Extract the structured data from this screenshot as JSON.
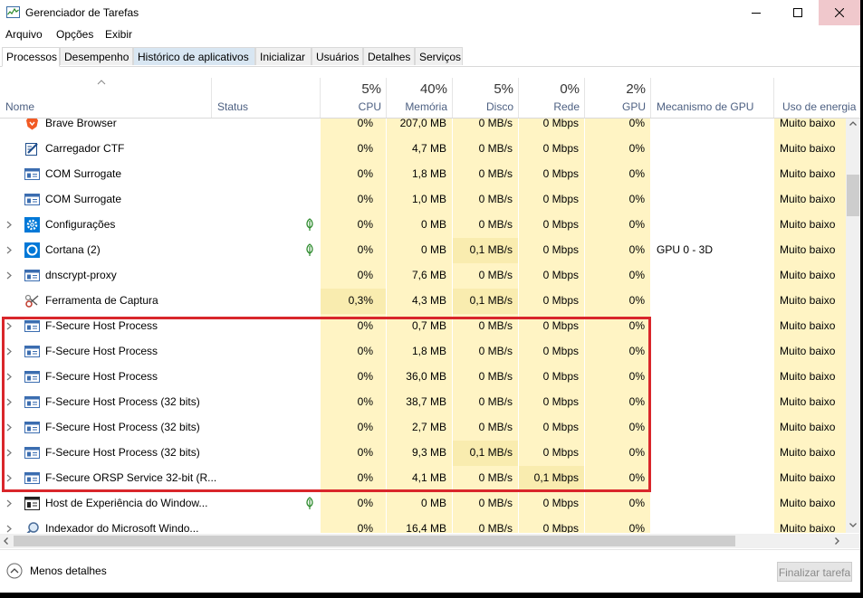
{
  "window": {
    "title": "Gerenciador de Tarefas"
  },
  "menu": [
    "Arquivo",
    "Opções",
    "Exibir"
  ],
  "tabs": [
    {
      "label": "Processos",
      "active": true
    },
    {
      "label": "Desempenho"
    },
    {
      "label": "Histórico de aplicativos",
      "hover": true
    },
    {
      "label": "Inicializar"
    },
    {
      "label": "Usuários"
    },
    {
      "label": "Detalhes"
    },
    {
      "label": "Serviços"
    }
  ],
  "columns": {
    "name": "Nome",
    "status": "Status",
    "cpu": {
      "pct": "5%",
      "label": "CPU"
    },
    "memory": {
      "pct": "40%",
      "label": "Memória"
    },
    "disk": {
      "pct": "5%",
      "label": "Disco"
    },
    "network": {
      "pct": "0%",
      "label": "Rede"
    },
    "gpu": {
      "pct": "2%",
      "label": "GPU"
    },
    "gpu_engine": "Mecanismo de GPU",
    "power": "Uso de energia"
  },
  "processes": [
    {
      "name": "Brave Browser",
      "icon": "brave-lion-icon",
      "expand": false,
      "leaf": false,
      "cpu": "0%",
      "mem": "207,0 MB",
      "disk": "0 MB/s",
      "net": "0 Mbps",
      "gpu": "0%",
      "engine": "",
      "power": "Muito baixo"
    },
    {
      "name": "Carregador CTF",
      "icon": "ctf-pen-icon",
      "expand": false,
      "leaf": false,
      "cpu": "0%",
      "mem": "4,7 MB",
      "disk": "0 MB/s",
      "net": "0 Mbps",
      "gpu": "0%",
      "engine": "",
      "power": "Muito baixo"
    },
    {
      "name": "COM Surrogate",
      "icon": "process-window-icon",
      "expand": false,
      "leaf": false,
      "cpu": "0%",
      "mem": "1,8 MB",
      "disk": "0 MB/s",
      "net": "0 Mbps",
      "gpu": "0%",
      "engine": "",
      "power": "Muito baixo"
    },
    {
      "name": "COM Surrogate",
      "icon": "process-window-icon",
      "expand": false,
      "leaf": false,
      "cpu": "0%",
      "mem": "1,0 MB",
      "disk": "0 MB/s",
      "net": "0 Mbps",
      "gpu": "0%",
      "engine": "",
      "power": "Muito baixo"
    },
    {
      "name": "Configurações",
      "icon": "gear-icon",
      "expand": true,
      "leaf": true,
      "cpu": "0%",
      "mem": "0 MB",
      "disk": "0 MB/s",
      "net": "0 Mbps",
      "gpu": "0%",
      "engine": "",
      "power": "Muito baixo"
    },
    {
      "name": "Cortana (2)",
      "icon": "cortana-ring-icon",
      "expand": true,
      "leaf": true,
      "cpu": "0%",
      "mem": "0 MB",
      "disk": "0,1 MB/s",
      "net": "0 Mbps",
      "gpu": "0%",
      "engine": "GPU 0 - 3D",
      "power": "Muito baixo"
    },
    {
      "name": "dnscrypt-proxy",
      "icon": "process-window-icon",
      "expand": true,
      "leaf": false,
      "cpu": "0%",
      "mem": "7,6 MB",
      "disk": "0 MB/s",
      "net": "0 Mbps",
      "gpu": "0%",
      "engine": "",
      "power": "Muito baixo"
    },
    {
      "name": "Ferramenta de Captura",
      "icon": "scissors-icon",
      "expand": false,
      "leaf": false,
      "cpu": "0,3%",
      "mem": "4,3 MB",
      "disk": "0,1 MB/s",
      "net": "0 Mbps",
      "gpu": "0%",
      "engine": "",
      "power": "Muito baixo"
    },
    {
      "name": "F-Secure Host Process",
      "icon": "process-window-icon",
      "expand": true,
      "leaf": false,
      "cpu": "0%",
      "mem": "0,7 MB",
      "disk": "0 MB/s",
      "net": "0 Mbps",
      "gpu": "0%",
      "engine": "",
      "power": "Muito baixo"
    },
    {
      "name": "F-Secure Host Process",
      "icon": "process-window-icon",
      "expand": true,
      "leaf": false,
      "cpu": "0%",
      "mem": "1,8 MB",
      "disk": "0 MB/s",
      "net": "0 Mbps",
      "gpu": "0%",
      "engine": "",
      "power": "Muito baixo"
    },
    {
      "name": "F-Secure Host Process",
      "icon": "process-window-icon",
      "expand": true,
      "leaf": false,
      "cpu": "0%",
      "mem": "36,0 MB",
      "disk": "0 MB/s",
      "net": "0 Mbps",
      "gpu": "0%",
      "engine": "",
      "power": "Muito baixo"
    },
    {
      "name": "F-Secure Host Process (32 bits)",
      "icon": "process-window-icon",
      "expand": true,
      "leaf": false,
      "cpu": "0%",
      "mem": "38,7 MB",
      "disk": "0 MB/s",
      "net": "0 Mbps",
      "gpu": "0%",
      "engine": "",
      "power": "Muito baixo"
    },
    {
      "name": "F-Secure Host Process (32 bits)",
      "icon": "process-window-icon",
      "expand": true,
      "leaf": false,
      "cpu": "0%",
      "mem": "2,7 MB",
      "disk": "0 MB/s",
      "net": "0 Mbps",
      "gpu": "0%",
      "engine": "",
      "power": "Muito baixo"
    },
    {
      "name": "F-Secure Host Process (32 bits)",
      "icon": "process-window-icon",
      "expand": true,
      "leaf": false,
      "cpu": "0%",
      "mem": "9,3 MB",
      "disk": "0,1 MB/s",
      "net": "0 Mbps",
      "gpu": "0%",
      "engine": "",
      "power": "Muito baixo"
    },
    {
      "name": "F-Secure ORSP Service 32-bit (R...",
      "icon": "process-window-icon",
      "expand": true,
      "leaf": false,
      "cpu": "0%",
      "mem": "4,1 MB",
      "disk": "0 MB/s",
      "net": "0,1 Mbps",
      "gpu": "0%",
      "engine": "",
      "power": "Muito baixo"
    },
    {
      "name": "Host de Experiência do Window...",
      "icon": "host-window-icon",
      "expand": true,
      "leaf": true,
      "cpu": "0%",
      "mem": "0 MB",
      "disk": "0 MB/s",
      "net": "0 Mbps",
      "gpu": "0%",
      "engine": "",
      "power": "Muito baixo"
    },
    {
      "name": "Indexador do Microsoft Windo...",
      "icon": "indexer-magnifier-icon",
      "expand": true,
      "leaf": false,
      "cpu": "0%",
      "mem": "16,4 MB",
      "disk": "0 MB/s",
      "net": "0 Mbps",
      "gpu": "0%",
      "engine": "",
      "power": "Muito baixo"
    }
  ],
  "footer": {
    "less_details": "Menos detalhes",
    "end_task": "Finalizar tarefa"
  },
  "colors": {
    "heat_light": "#fff4c4",
    "heat_dark": "#f9ecaf",
    "highlight": "#d9262b"
  }
}
